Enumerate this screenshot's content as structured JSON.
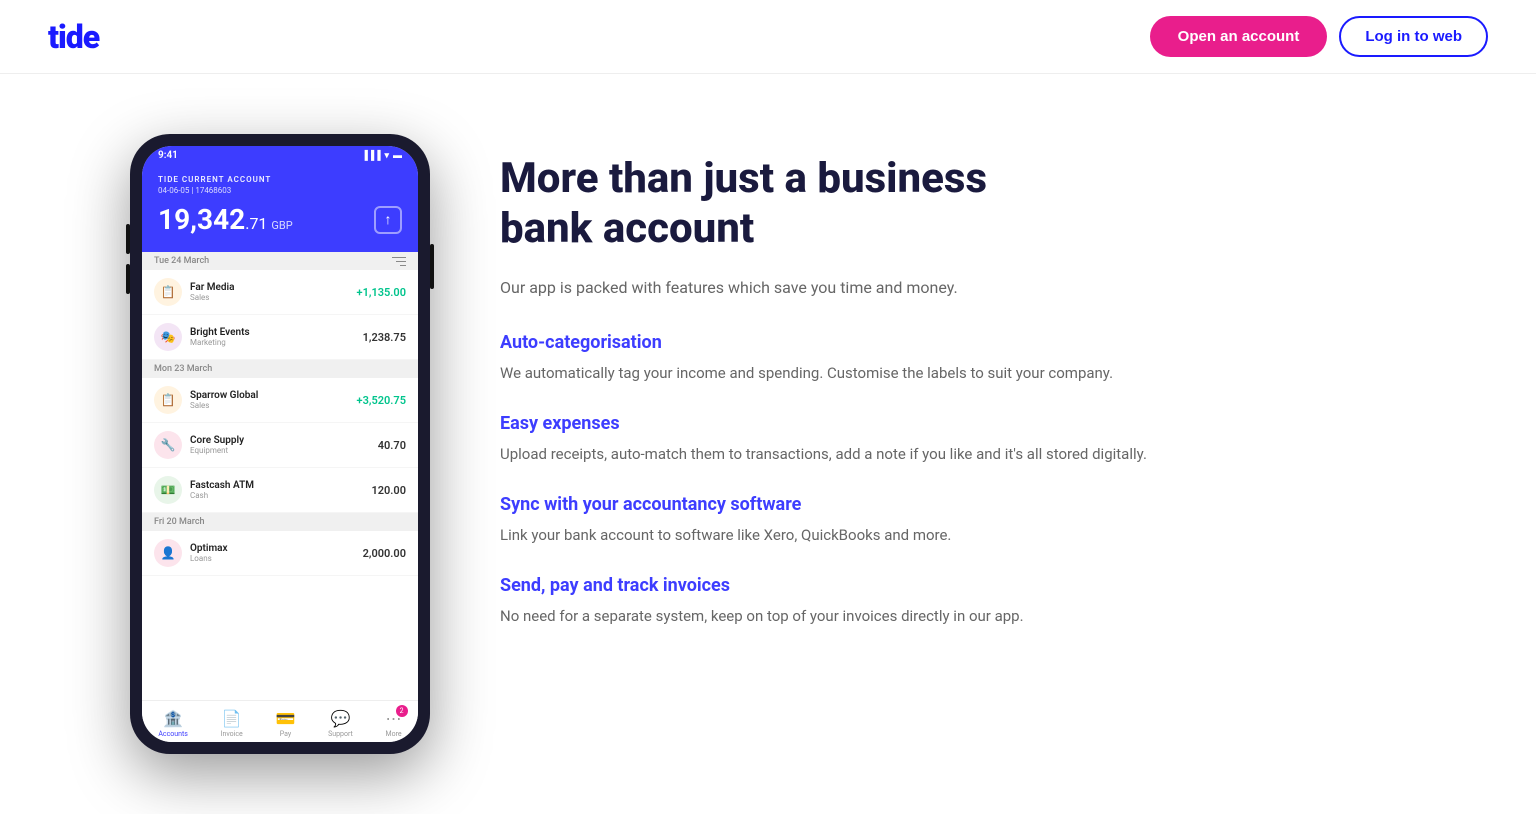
{
  "header": {
    "logo": "tide",
    "open_account_label": "Open an account",
    "login_label": "Log in to web"
  },
  "phone": {
    "status_time": "9:41",
    "account_label": "TIDE CURRENT ACCOUNT",
    "account_number": "04-06-05 | 17468603",
    "balance": "19,342",
    "balance_dec": ".71",
    "balance_currency": "GBP",
    "date1": "Tue 24 March",
    "date2": "Mon 23 March",
    "date3": "Fri 20 March",
    "transactions": [
      {
        "name": "Far Media",
        "category": "Sales",
        "amount": "+1,135.00",
        "positive": true,
        "color": "#f5a623",
        "icon": "📋"
      },
      {
        "name": "Bright Events",
        "category": "Marketing",
        "amount": "1,238.75",
        "positive": false,
        "color": "#9b59b6",
        "icon": "🎭"
      },
      {
        "name": "Sparrow Global",
        "category": "Sales",
        "amount": "+3,520.75",
        "positive": true,
        "color": "#f5a623",
        "icon": "📋"
      },
      {
        "name": "Core Supply",
        "category": "Equipment",
        "amount": "40.70",
        "positive": false,
        "color": "#e74c3c",
        "icon": "🔧"
      },
      {
        "name": "Fastcash ATM",
        "category": "Cash",
        "amount": "120.00",
        "positive": false,
        "color": "#2ecc71",
        "icon": "💵"
      },
      {
        "name": "Optimax",
        "category": "Loans",
        "amount": "2,000.00",
        "positive": false,
        "color": "#ff6b9d",
        "icon": "👤"
      }
    ],
    "nav": [
      {
        "label": "Accounts",
        "active": true
      },
      {
        "label": "Invoice",
        "active": false
      },
      {
        "label": "Pay",
        "active": false
      },
      {
        "label": "Support",
        "active": false
      },
      {
        "label": "More",
        "active": false,
        "badge": "2"
      }
    ]
  },
  "content": {
    "heading_line1": "More than just a business",
    "heading_line2": "bank account",
    "sub_text": "Our app is packed with features which save you time and money.",
    "features": [
      {
        "title": "Auto-categorisation",
        "desc": "We automatically tag your income and spending. Customise the labels to suit your company."
      },
      {
        "title": "Easy expenses",
        "desc": "Upload receipts, auto-match them to transactions, add a note if you like and it's all stored digitally."
      },
      {
        "title": "Sync with your accountancy software",
        "desc": "Link your bank account to software like Xero, QuickBooks and more."
      },
      {
        "title": "Send, pay and track invoices",
        "desc": "No need for a separate system, keep on top of your invoices directly in our app."
      }
    ]
  }
}
